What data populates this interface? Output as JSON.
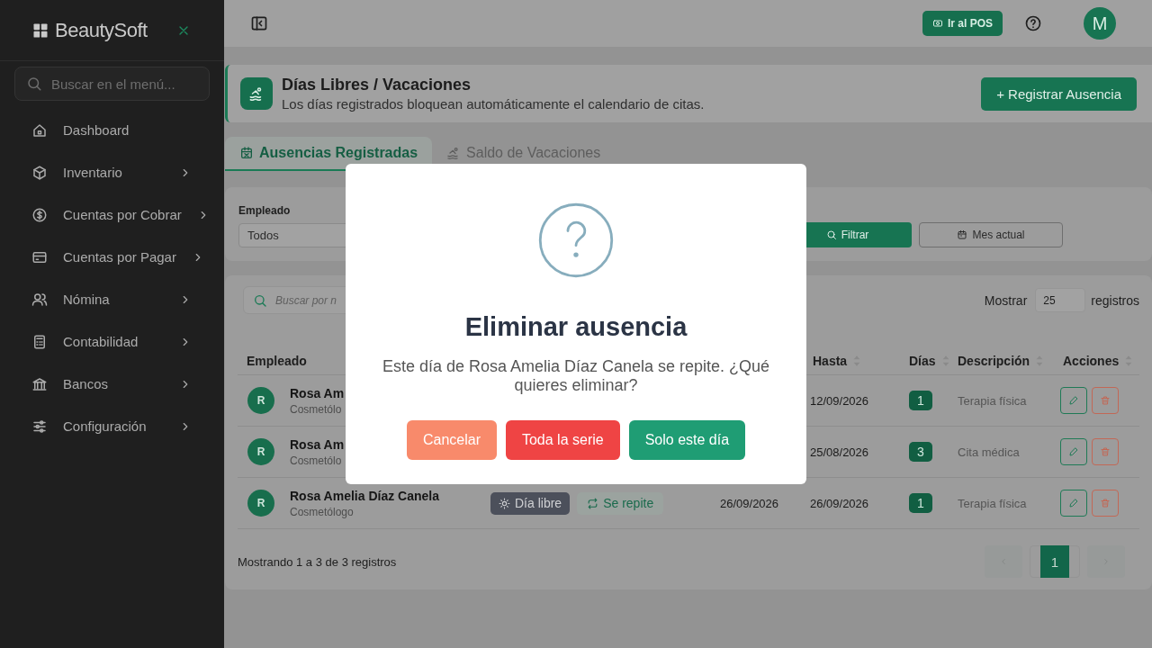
{
  "sidebar": {
    "brand": "BeautySoft",
    "search": {
      "placeholder": "Buscar en el menú..."
    },
    "items": [
      {
        "label": "Dashboard",
        "has_submenu": false
      },
      {
        "label": "Inventario",
        "has_submenu": true
      },
      {
        "label": "Cuentas por Cobrar",
        "has_submenu": true
      },
      {
        "label": "Cuentas por Pagar",
        "has_submenu": true
      },
      {
        "label": "Nómina",
        "has_submenu": true
      },
      {
        "label": "Contabilidad",
        "has_submenu": true
      },
      {
        "label": "Bancos",
        "has_submenu": true
      },
      {
        "label": "Configuración",
        "has_submenu": true
      }
    ]
  },
  "topbar": {
    "pos_button": "Ir al POS",
    "avatar": "M"
  },
  "header": {
    "title": "Días Libres / Vacaciones",
    "subtitle": "Los días registrados bloquean automáticamente el calendario de citas.",
    "action": "+ Registrar Ausencia"
  },
  "tabs": [
    {
      "label": "Ausencias Registradas",
      "selected": true
    },
    {
      "label": "Saldo de Vacaciones",
      "selected": false
    }
  ],
  "filters": {
    "employee_label": "Empleado",
    "employee_value": "Todos",
    "filter_button": "Filtrar",
    "month_button": "Mes actual"
  },
  "table": {
    "search": {
      "placeholder": "Buscar por n"
    },
    "show_label": "Mostrar",
    "page_size": "25",
    "records_label": "registros",
    "columns": [
      "Empleado",
      "Hasta",
      "Días",
      "Descripción",
      "Acciones"
    ],
    "rows": [
      {
        "initial": "R",
        "name": "Rosa Am",
        "role": "Cosmetólo",
        "to": "12/09/2026",
        "days": "1",
        "description": "Terapia física"
      },
      {
        "initial": "R",
        "name": "Rosa Am",
        "role": "Cosmetólo",
        "to": "25/08/2026",
        "days": "3",
        "description": "Cita médica"
      },
      {
        "initial": "R",
        "name": "Rosa Amelia Díaz Canela",
        "role": "Cosmetólogo",
        "type": "Día libre",
        "repeat": "Se repite",
        "from": "26/09/2026",
        "to": "26/09/2026",
        "days": "1",
        "description": "Terapia física"
      }
    ],
    "footer": "Mostrando 1 a 3 de 3 registros",
    "pages": [
      {
        "label": "1",
        "selected": true
      }
    ]
  },
  "modal": {
    "title": "Eliminar ausencia",
    "message": "Este día de Rosa Amelia Díaz Canela se repite. ¿Qué quieres eliminar?",
    "buttons": [
      {
        "label": "Cancelar",
        "kind": "cancel"
      },
      {
        "label": "Toda la serie",
        "kind": "danger"
      },
      {
        "label": "Solo este día",
        "kind": "confirm"
      }
    ]
  }
}
